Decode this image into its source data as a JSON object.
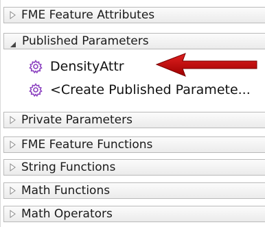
{
  "sections": {
    "fme_feature_attributes": {
      "label": "FME Feature Attributes",
      "expanded": false
    },
    "published_parameters": {
      "label": "Published Parameters",
      "expanded": true,
      "items": [
        {
          "label": "DensityAttr",
          "icon": "parameter-gear-icon"
        },
        {
          "label": "<Create Published Paramete...",
          "icon": "parameter-gear-icon"
        }
      ]
    },
    "private_parameters": {
      "label": "Private Parameters",
      "expanded": false
    },
    "fme_feature_functions": {
      "label": "FME Feature Functions",
      "expanded": false
    },
    "string_functions": {
      "label": "String Functions",
      "expanded": false
    },
    "math_functions": {
      "label": "Math Functions",
      "expanded": false
    },
    "math_operators": {
      "label": "Math Operators",
      "expanded": false
    }
  },
  "annotation": {
    "icon": "red-arrow-icon",
    "color": "#cc0000"
  },
  "colors": {
    "gear": "#8a3fbf",
    "header_border": "#b9b9b9"
  }
}
